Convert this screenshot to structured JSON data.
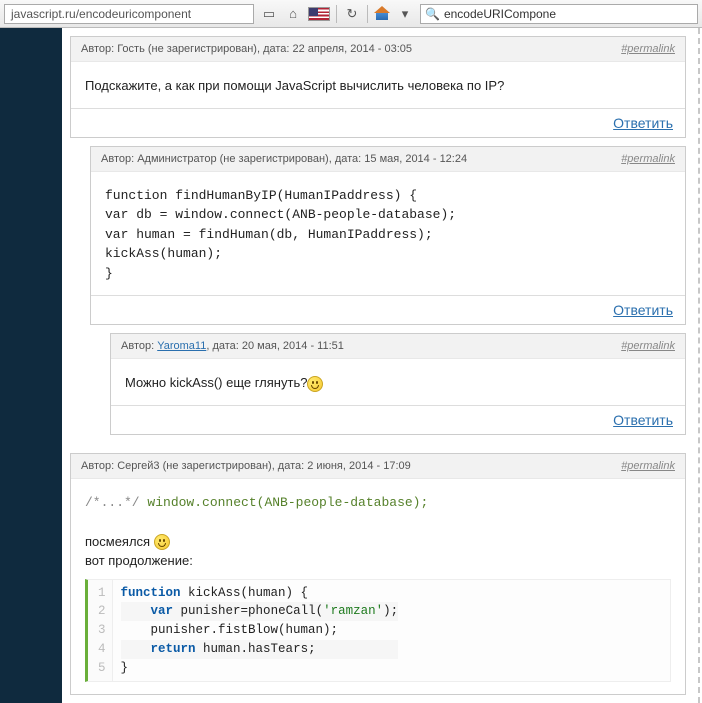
{
  "browser": {
    "url": "javascript.ru/encodeuricomponent",
    "search_value": "encodeURICompone",
    "refresh_glyph": "↻",
    "dropdown_glyph": "▾",
    "search_glyph": "🔍",
    "book_glyph": "▭",
    "home_glyph": "⌂"
  },
  "labels": {
    "author_prefix": "Автор: ",
    "date_prefix": ", дата: ",
    "not_registered": " (не зарегистрирован)",
    "permalink": "#permalink",
    "reply": "Ответить"
  },
  "comments": [
    {
      "author": "Гость",
      "is_link": false,
      "registered": false,
      "date": "22 апреля, 2014 - 03:05",
      "body_text": "Подскажите, а как при помощи JavaScript вычислить человека по IP?"
    },
    {
      "author": "Администратор",
      "is_link": false,
      "registered": false,
      "date": "15 мая, 2014 - 12:24",
      "code_plain": "function findHumanByIP(HumanIPaddress) {\nvar db = window.connect(ANB-people-database);\nvar human = findHuman(db, HumanIPaddress);\nkickAss(human);\n}"
    },
    {
      "author": "Yaroma11",
      "is_link": true,
      "registered": true,
      "date": "20 мая, 2014 - 11:51",
      "body_text_pre": "Можно kickAss() еще глянуть?",
      "has_smiley": true
    },
    {
      "author": "Сергей3",
      "is_link": false,
      "registered": false,
      "date": "2 июня, 2014 - 17:09",
      "inline_code": "/*...*/ window.connect(ANB-people-database);",
      "para1": "посмеялся ",
      "para2": "вот продолжение:",
      "code_hl": {
        "lines": [
          {
            "n": "1",
            "seg": [
              [
                "kw",
                "function"
              ],
              [
                "",
                " kickAss(human) {"
              ]
            ]
          },
          {
            "n": "2",
            "seg": [
              [
                "",
                "    "
              ],
              [
                "kw",
                "var"
              ],
              [
                "",
                " punisher=phoneCall("
              ],
              [
                "str",
                "'ramzan'"
              ],
              [
                "",
                ");"
              ]
            ]
          },
          {
            "n": "3",
            "seg": [
              [
                "",
                "    punisher.fistBlow(human);"
              ]
            ]
          },
          {
            "n": "4",
            "seg": [
              [
                "",
                "    "
              ],
              [
                "kw",
                "return"
              ],
              [
                "",
                " human.hasTears;"
              ]
            ]
          },
          {
            "n": "5",
            "seg": [
              [
                "",
                "}"
              ]
            ]
          }
        ]
      }
    }
  ]
}
